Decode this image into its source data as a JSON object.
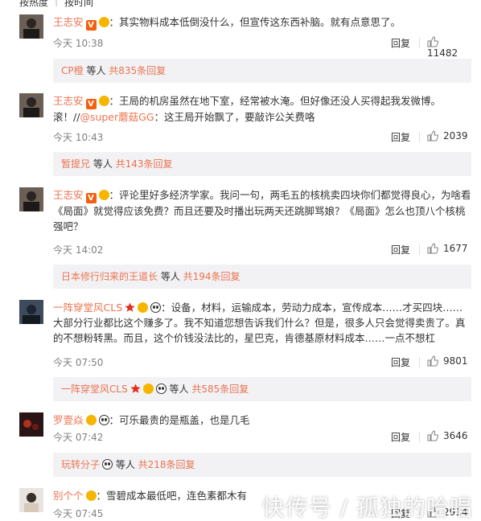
{
  "sort_bar": {
    "hot": "按热度",
    "time": "按时间"
  },
  "comments": [
    {
      "user": "王志安",
      "badges": [
        "v",
        "crown"
      ],
      "text": "：其实物料成本低倒没什么，但宣传这东西补脑。就有点意思了。",
      "time": "今天 10:38",
      "reply_label": "回复",
      "likes": "11482",
      "sub": {
        "who": "CP橙",
        "mid": " 等人 ",
        "count": "共835条回复"
      }
    },
    {
      "user": "王志安",
      "badges": [
        "v",
        "crown"
      ],
      "text_a": "：王局的机房虽然在地下室，经常被水淹。但好像还没人买得起我发微博。",
      "text_b": "滚！//",
      "at": "@super蘑菇GG",
      "text_c": "：这王局开始飘了，要敲诈公关费咯",
      "time": "今天 10:43",
      "reply_label": "回复",
      "likes": "2039",
      "sub": {
        "who": "暂提兄",
        "mid": " 等人 ",
        "count": "共143条回复"
      }
    },
    {
      "user": "王志安",
      "badges": [
        "v",
        "crown"
      ],
      "text": "：评论里好多经济学家。我问一句，两毛五的核桃卖四块你们都觉得良心，为啥看《局面》就觉得应该免费？而且还要及时播出玩两天还跳脚骂娘？《局面》怎么也顶八个核桃强吧？",
      "time": "今天 14:02",
      "reply_label": "回复",
      "likes": "1677",
      "sub": {
        "who": "日本修行归来的王道长",
        "mid": " 等人 ",
        "count": "共194条回复"
      }
    },
    {
      "user": "一阵穿堂风CLS",
      "badges": [
        "star",
        "crown",
        "panda"
      ],
      "text": "：设备，材料，运输成本，劳动力成本，宣传成本……才买四块……大部分行业都比这个赚多了。我不知道您想告诉我们什么？但是，很多人只会觉得卖贵了。真的不想粉转黑。而且，这个价钱没法比的，星巴克，肯德基原材料成本……一点不想杠",
      "time": "今天 07:50",
      "reply_label": "回复",
      "likes": "9801",
      "sub": {
        "who": "一阵穿堂风CLS",
        "mid": " 等人 ",
        "count": "共585条回复"
      }
    },
    {
      "user": "罗壹焱",
      "badges": [
        "crown",
        "panda"
      ],
      "text": "：可乐最贵的是瓶盖，也是几毛",
      "time": "今天 07:42",
      "reply_label": "回复",
      "likes": "3646",
      "sub": {
        "who": "玩转分子",
        "mid": " 等人 ",
        "count": "共218条回复"
      }
    },
    {
      "user": "别个个",
      "badges": [
        "crown"
      ],
      "text": "：雪碧成本最低吧，连色素都木有",
      "time": "今天 07:45",
      "reply_label": "回复",
      "likes": "2914"
    }
  ],
  "watermark": "快传号 / 孤独的哈唱",
  "colors": {
    "name": "#eb7350",
    "meta": "#808080",
    "sub_bg": "#f2f2f5"
  }
}
